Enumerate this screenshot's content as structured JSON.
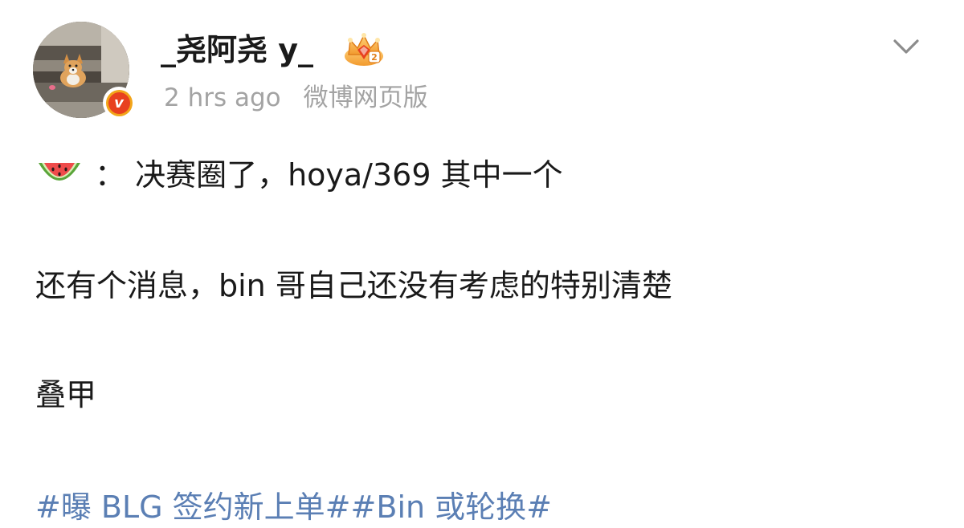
{
  "header": {
    "username": "_尧阿尧 y_",
    "time": "2 hrs ago",
    "source": "微博网页版",
    "badge_letter": "v"
  },
  "icons": {
    "avatar": "corgi-avatar",
    "verified": "verified-v-badge",
    "crown": "crown-level-2-icon",
    "more": "chevron-down-icon",
    "emoji": "watermelon-icon"
  },
  "crown_level": "2",
  "post": {
    "line1": "： 决赛圈了，hoya/369 其中一个",
    "line2": "还有个消息，bin 哥自己还没有考虑的特别清楚",
    "line3": "叠甲",
    "hashtag1": "#曝 BLG 签约新上单#",
    "hashtag2": "#Bin 或轮换#"
  },
  "colors": {
    "text": "#1a1a1a",
    "meta": "#a3a3a3",
    "hashtag": "#5b7fb4",
    "badge_orange": "#f2a51a",
    "badge_red": "#e8411f"
  }
}
